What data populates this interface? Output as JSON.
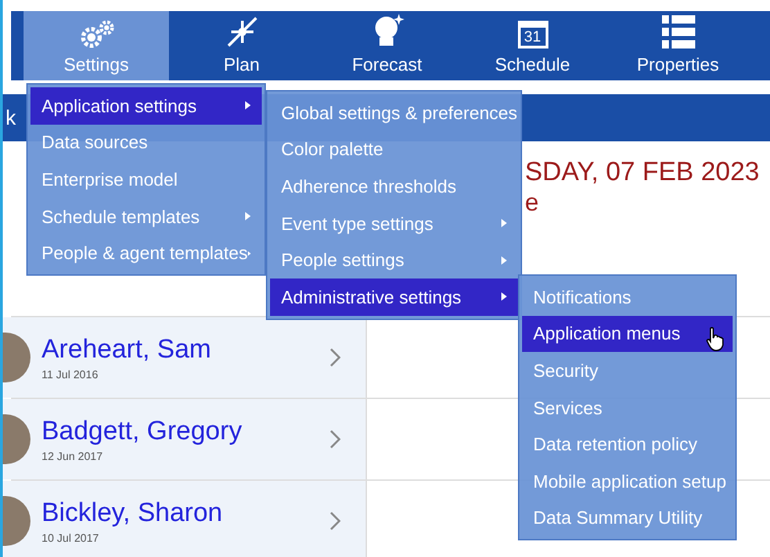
{
  "nav": [
    {
      "label": "Settings",
      "selected": true
    },
    {
      "label": "Plan",
      "selected": false
    },
    {
      "label": "Forecast",
      "selected": false
    },
    {
      "label": "Schedule",
      "calendar_day": "31",
      "selected": false
    },
    {
      "label": "Properties",
      "selected": false
    }
  ],
  "breadcrumb_fragment": "k",
  "heading": "SDAY, 07 FEB 2023",
  "subheading": "e",
  "people": [
    {
      "name": "Areheart, Sam",
      "date": "11 Jul 2016"
    },
    {
      "name": "Badgett, Gregory",
      "date": "12 Jun 2017"
    },
    {
      "name": "Bickley, Sharon",
      "date": "10 Jul 2017"
    }
  ],
  "menus": [
    {
      "items": [
        {
          "label": "Application settings",
          "selected": true,
          "submenu": true
        },
        {
          "label": "Data sources",
          "selected": false,
          "submenu": false
        },
        {
          "label": "Enterprise model",
          "selected": false,
          "submenu": false
        },
        {
          "label": "Schedule templates",
          "selected": false,
          "submenu": true
        },
        {
          "label": "People & agent templates",
          "selected": false,
          "submenu": true
        }
      ]
    },
    {
      "items": [
        {
          "label": "Global settings & preferences",
          "selected": false,
          "submenu": false
        },
        {
          "label": "Color palette",
          "selected": false,
          "submenu": false
        },
        {
          "label": "Adherence thresholds",
          "selected": false,
          "submenu": false
        },
        {
          "label": "Event type settings",
          "selected": false,
          "submenu": true
        },
        {
          "label": "People settings",
          "selected": false,
          "submenu": true
        },
        {
          "label": "Administrative settings",
          "selected": true,
          "submenu": true
        }
      ]
    },
    {
      "items": [
        {
          "label": "Notifications",
          "selected": false,
          "submenu": false
        },
        {
          "label": "Application menus",
          "selected": true,
          "submenu": false,
          "hovered": true
        },
        {
          "label": "Security",
          "selected": false,
          "submenu": false
        },
        {
          "label": "Services",
          "selected": false,
          "submenu": false
        },
        {
          "label": "Data retention policy",
          "selected": false,
          "submenu": false
        },
        {
          "label": "Mobile application setup",
          "selected": false,
          "submenu": false
        },
        {
          "label": "Data Summary Utility",
          "selected": false,
          "submenu": false
        }
      ]
    }
  ]
}
